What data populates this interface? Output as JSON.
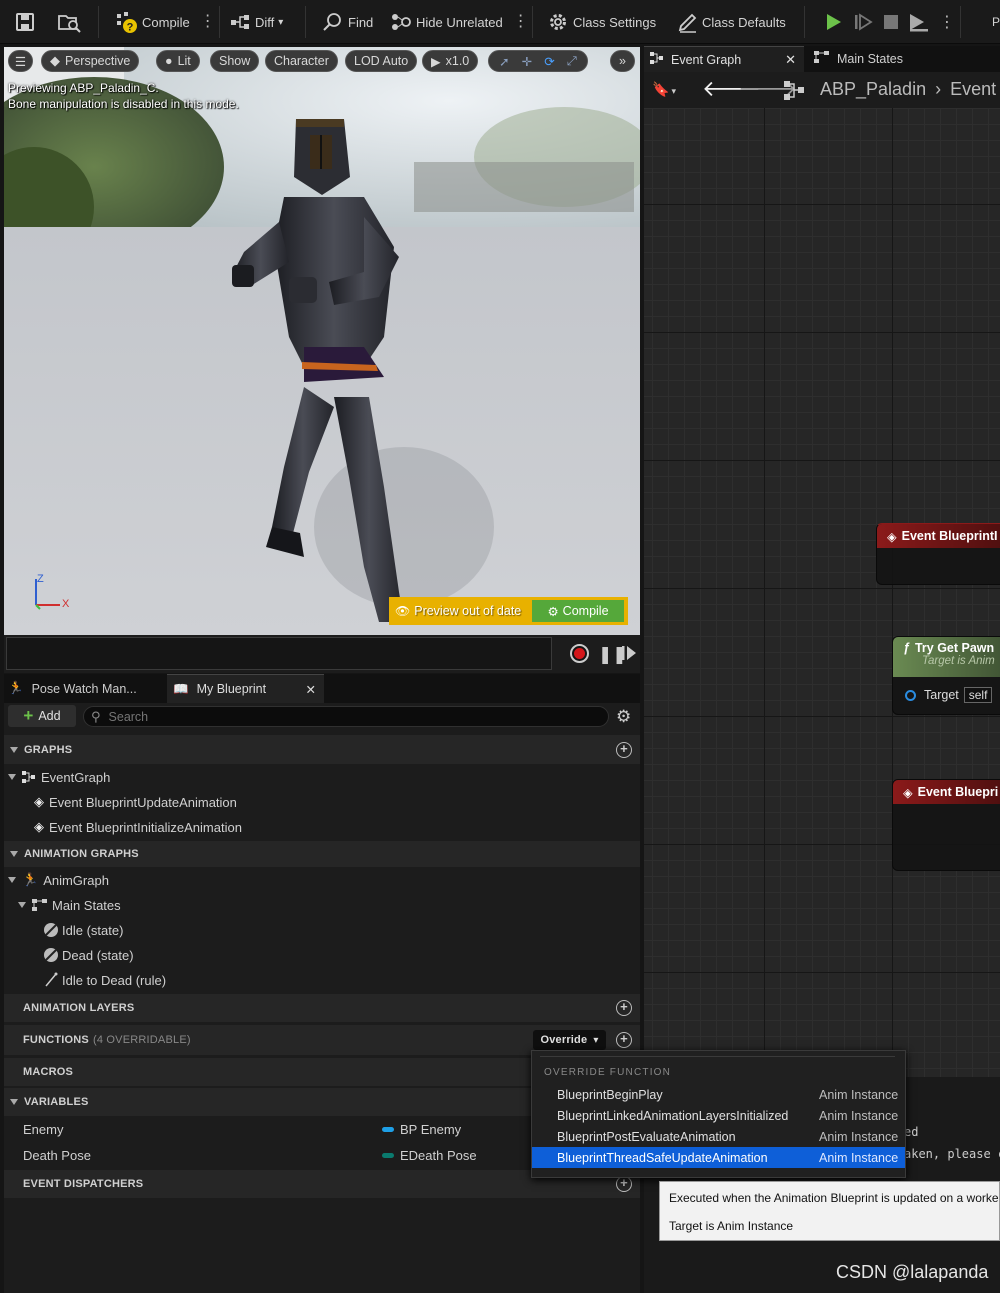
{
  "toolbar": {
    "compile": "Compile",
    "diff": "Diff",
    "find": "Find",
    "hide_unrelated": "Hide Unrelated",
    "class_settings": "Class Settings",
    "class_defaults": "Class Defaults"
  },
  "viewport": {
    "perspective": "Perspective",
    "lit": "Lit",
    "show": "Show",
    "character": "Character",
    "lod": "LOD Auto",
    "speed": "x1.0",
    "preview_line1": "Previewing ABP_Paladin_C.",
    "preview_line2": "Bone manipulation is disabled in this mode.",
    "preview_out_of_date": "Preview out of date",
    "compile_btn": "Compile",
    "axis_z": "Z",
    "axis_x": "X"
  },
  "graph_tabs": {
    "event_graph": "Event Graph",
    "main_states": "Main States"
  },
  "breadcrumb": {
    "root": "ABP_Paladin",
    "child": "Event"
  },
  "graph_nodes": {
    "node1": "Event BlueprintI",
    "node2_title": "Try Get Pawn",
    "node2_sub": "Target is Anim",
    "node2_pin": "Target",
    "node2_pin_val": "self",
    "node3": "Event Bluepri"
  },
  "panel_tabs": {
    "pose_watch": "Pose Watch Man...",
    "my_blueprint": "My Blueprint"
  },
  "panel": {
    "add": "Add",
    "search_placeholder": "Search"
  },
  "sections": {
    "graphs": "GRAPHS",
    "anim_graphs": "ANIMATION GRAPHS",
    "anim_layers": "ANIMATION LAYERS",
    "functions": "FUNCTIONS",
    "functions_count": "(4 OVERRIDABLE)",
    "override": "Override",
    "macros": "MACROS",
    "variables": "VARIABLES",
    "dispatchers": "EVENT DISPATCHERS"
  },
  "graphs": {
    "event_graph": "EventGraph",
    "update": "Event BlueprintUpdateAnimation",
    "init": "Event BlueprintInitializeAnimation"
  },
  "anim": {
    "anim_graph": "AnimGraph",
    "main_states": "Main States",
    "idle": "Idle (state)",
    "dead": "Dead (state)",
    "rule": "Idle to Dead (rule)"
  },
  "variables": [
    {
      "name": "Enemy",
      "type": "BP Enemy",
      "color": "#1e9fe6"
    },
    {
      "name": "Death Pose",
      "type": "EDeath Pose",
      "color": "#0a7a6e"
    }
  ],
  "override_menu": {
    "header": "OVERRIDE FUNCTION",
    "items": [
      {
        "name": "BlueprintBeginPlay",
        "cls": "Anim Instance"
      },
      {
        "name": "BlueprintLinkedAnimationLayersInitialized",
        "cls": "Anim Instance"
      },
      {
        "name": "BlueprintPostEvaluateAnimation",
        "cls": "Anim Instance"
      },
      {
        "name": "BlueprintThreadSafeUpdateAnimation",
        "cls": "Anim Instance"
      }
    ]
  },
  "details_fragments": {
    "frag1": "ed",
    "frag2": "aken, please c"
  },
  "tooltip": {
    "line1": "Executed when the Animation Blueprint is updated on a worke",
    "line2": "Target is Anim Instance"
  },
  "watermark": "CSDN @lalapanda",
  "colors": {
    "accent_green": "#6cc24a",
    "event_red": "#8b1a1a",
    "function_green": "#6a8a52",
    "selection_blue": "#0e5fd8",
    "preview_yellow": "#e8b100"
  }
}
